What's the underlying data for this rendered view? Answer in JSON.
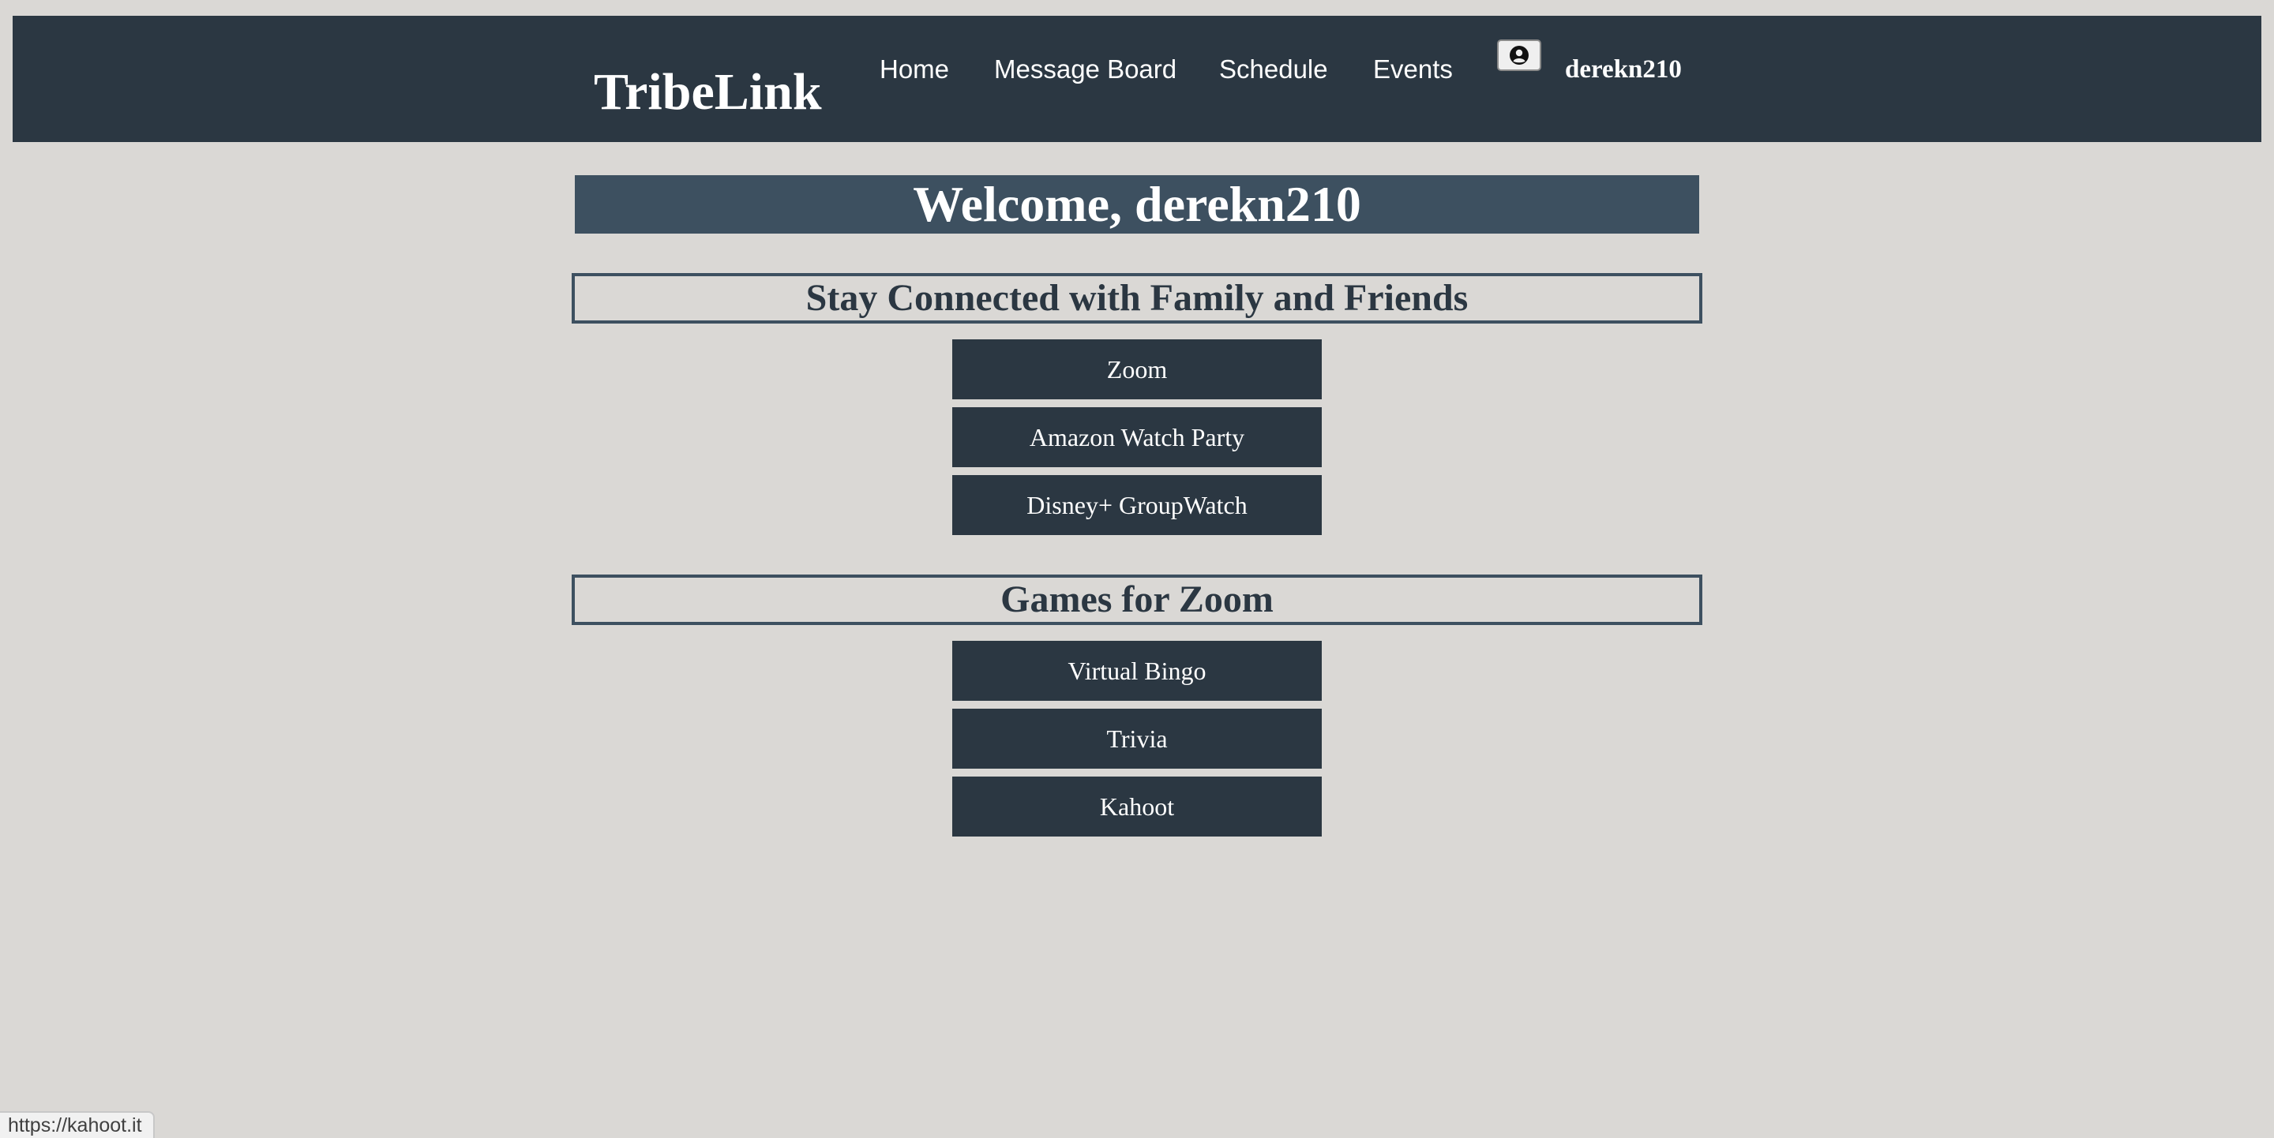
{
  "nav": {
    "brand": "TribeLink",
    "links": [
      "Home",
      "Message Board",
      "Schedule",
      "Events"
    ],
    "user_icon": "user-circle-icon",
    "username": "derekn210"
  },
  "welcome": "Welcome, derekn210",
  "sections": [
    {
      "heading": "Stay Connected with Family and Friends",
      "buttons": [
        "Zoom",
        "Amazon Watch Party",
        "Disney+ GroupWatch"
      ]
    },
    {
      "heading": "Games for Zoom",
      "buttons": [
        "Virtual Bingo",
        "Trivia",
        "Kahoot"
      ]
    }
  ],
  "status_url": "https://kahoot.it",
  "colors": {
    "navbar": "#2b3742",
    "welcome_banner": "#3d5060",
    "button": "#2b3742",
    "background": "#dad8d5"
  }
}
